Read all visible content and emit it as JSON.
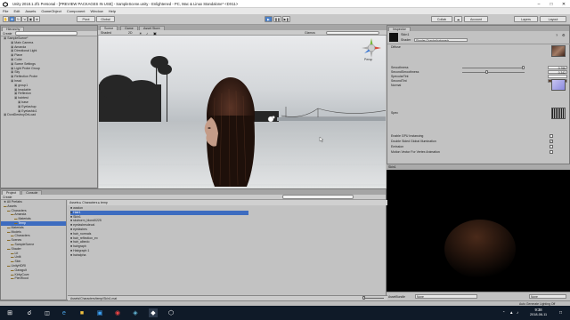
{
  "window": {
    "title": "Unity 2018.1.2f1 Personal - [PREVIEW PACKAGES IN USE] - SampleScene.unity - Enlightened - PC, Mac & Linux Standalone* <DX11>",
    "min_icon": "minimize-icon",
    "max_icon": "maximize-icon",
    "close_icon": "close-icon"
  },
  "menu": [
    "File",
    "Edit",
    "Assets",
    "GameObject",
    "Component",
    "Window",
    "Help"
  ],
  "toolbar": {
    "pivot": "Pivot",
    "global": "Global",
    "collab": "Collab",
    "account": "Account",
    "layers": "Layers",
    "layout": "Layout"
  },
  "hierarchy": {
    "tab": "Hierarchy",
    "create": "Create",
    "search_placeholder": "All",
    "items": [
      {
        "label": "SampleScene*",
        "indent": 0,
        "selected": false
      },
      {
        "label": "Main Camera",
        "indent": 2,
        "selected": false
      },
      {
        "label": "Amanda",
        "indent": 2,
        "selected": false
      },
      {
        "label": "Directional Light",
        "indent": 2,
        "selected": false
      },
      {
        "label": "Plane",
        "indent": 2,
        "selected": false
      },
      {
        "label": "Cube",
        "indent": 2,
        "selected": false
      },
      {
        "label": "Scene Settings",
        "indent": 2,
        "selected": false
      },
      {
        "label": "Light Probe Group",
        "indent": 2,
        "selected": false
      },
      {
        "label": "Sky",
        "indent": 2,
        "selected": false
      },
      {
        "label": "Reflection Probe",
        "indent": 2,
        "selected": false
      },
      {
        "label": "head",
        "indent": 2,
        "selected": false
      },
      {
        "label": "group1",
        "indent": 3,
        "selected": false
      },
      {
        "label": "headable",
        "indent": 3,
        "selected": false
      },
      {
        "label": "Reflexion",
        "indent": 3,
        "selected": false
      },
      {
        "label": "hairtest",
        "indent": 3,
        "selected": false
      },
      {
        "label": "base",
        "indent": 4,
        "selected": false
      },
      {
        "label": "Eyelashup",
        "indent": 4,
        "selected": false
      },
      {
        "label": "Eyelashlo1",
        "indent": 4,
        "selected": false
      },
      {
        "label": "DontDestroyOnLoad",
        "indent": 0,
        "selected": false
      }
    ]
  },
  "scene": {
    "tabs": [
      "Scene",
      "Game",
      "Asset Store"
    ],
    "shading": "Shaded",
    "mode_2d": "2D",
    "gizmos": "Gizmos",
    "gizmo_search_placeholder": "All",
    "view_label": "Persp"
  },
  "inspector": {
    "tab": "Inspector",
    "object_name": "Skin1",
    "shader_label": "Shader",
    "shader_value": "Shader Graphs/hairgraph",
    "section": "Diffuse",
    "fields": [
      {
        "label": "Smoothness",
        "value": "0.766"
      },
      {
        "label": "SecondSmoothness",
        "value": "0.342"
      },
      {
        "label": "SpecularTint",
        "value": ""
      },
      {
        "label": "SecondTint",
        "value": ""
      },
      {
        "label": "Normal",
        "value": ""
      },
      {
        "label": "Spec",
        "value": ""
      }
    ],
    "toggles": [
      {
        "label": "Enable GPU Instancing",
        "checked": false
      },
      {
        "label": "Double Sided Global Illumination",
        "checked": true
      },
      {
        "label": "Emission",
        "checked": false
      },
      {
        "label": "Motion Vector For Vertex Animation",
        "checked": false
      }
    ],
    "preview_title": "Skin1",
    "assetbundle_label": "AssetBundle",
    "assetbundle_value": "None",
    "assetbundle_variant": "None"
  },
  "project": {
    "tabs": [
      "Project",
      "Console"
    ],
    "create": "Create",
    "search_placeholder": "",
    "favorites_label": "All Prefabs",
    "left_tree": [
      {
        "label": "Assets",
        "indent": 0,
        "selected": false
      },
      {
        "label": "Characters",
        "indent": 1,
        "selected": false
      },
      {
        "label": "Amanda",
        "indent": 2,
        "selected": false
      },
      {
        "label": "Materials",
        "indent": 3,
        "selected": false
      },
      {
        "label": "Temp",
        "indent": 3,
        "selected": true
      },
      {
        "label": "Materials",
        "indent": 1,
        "selected": false
      },
      {
        "label": "Models",
        "indent": 1,
        "selected": false
      },
      {
        "label": "Characters",
        "indent": 2,
        "selected": false
      },
      {
        "label": "Scenes",
        "indent": 1,
        "selected": false
      },
      {
        "label": "SampleScene",
        "indent": 2,
        "selected": false
      },
      {
        "label": "Shader",
        "indent": 1,
        "selected": false
      },
      {
        "label": "Lit",
        "indent": 2,
        "selected": false
      },
      {
        "label": "Unlit",
        "indent": 2,
        "selected": false
      },
      {
        "label": "Skin",
        "indent": 2,
        "selected": false
      },
      {
        "label": "UnityHDRI",
        "indent": 1,
        "selected": false
      },
      {
        "label": "Garagult",
        "indent": 2,
        "selected": false
      },
      {
        "label": "KirbyCove",
        "indent": 2,
        "selected": false
      },
      {
        "label": "PierWood",
        "indent": 2,
        "selected": false
      }
    ],
    "breadcrumb": [
      "Assets",
      "Characters",
      "temp"
    ],
    "files": [
      {
        "label": "waxlon",
        "selected": false
      },
      {
        "label": "Hair1",
        "selected": true
      },
      {
        "label": "Skin1",
        "selected": false
      },
      {
        "label": "skuhorm_blond0225",
        "selected": false
      },
      {
        "label": "eyelashesdecal",
        "selected": false
      },
      {
        "label": "eyelashes",
        "selected": false
      },
      {
        "label": "hair_normals",
        "selected": false
      },
      {
        "label": "hair_reflection_ex",
        "selected": false
      },
      {
        "label": "hair_albedo",
        "selected": false
      },
      {
        "label": "hairgraph",
        "selected": false
      },
      {
        "label": "Hairgraph 1",
        "selected": false
      },
      {
        "label": "hairalpha",
        "selected": false
      }
    ],
    "status_path": "Assets/Characters/temp/Skin1.mat"
  },
  "statusbar": {
    "text": "Auto Generate Lighting Off"
  },
  "taskbar": {
    "clock_time": "9:38",
    "clock_date": "2018-06-11"
  }
}
